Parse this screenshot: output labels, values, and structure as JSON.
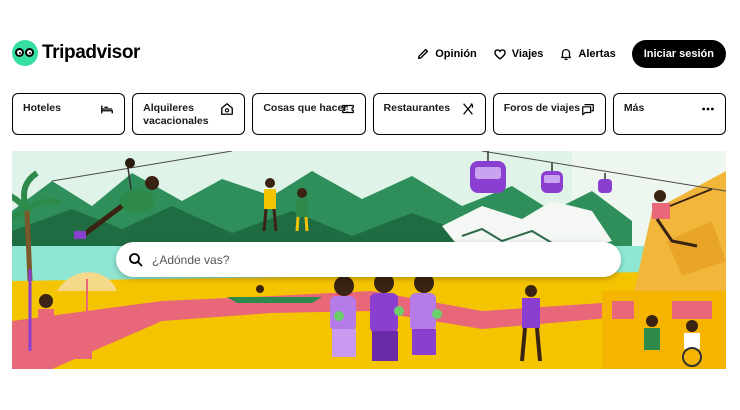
{
  "brand": {
    "name": "Tripadvisor",
    "accent": "#34e0a1"
  },
  "nav": {
    "review_label": "Opinión",
    "trips_label": "Viajes",
    "alerts_label": "Alertas",
    "login_label": "Iniciar sesión"
  },
  "tabs": [
    {
      "label": "Hoteles",
      "icon": "bed-icon"
    },
    {
      "label": "Alquileres vacacionales",
      "icon": "house-icon"
    },
    {
      "label": "Cosas que hacer",
      "icon": "ticket-icon"
    },
    {
      "label": "Restaurantes",
      "icon": "utensils-icon"
    },
    {
      "label": "Foros de viajes",
      "icon": "chat-icon"
    },
    {
      "label": "Más",
      "icon": "more-icon"
    }
  ],
  "search": {
    "placeholder": "¿Adónde vas?"
  },
  "colors": {
    "hero_green": "#2f8f5a",
    "hero_yellow": "#f5c400",
    "hero_pink": "#e8687a",
    "gondola_purple": "#8a3fd1"
  }
}
